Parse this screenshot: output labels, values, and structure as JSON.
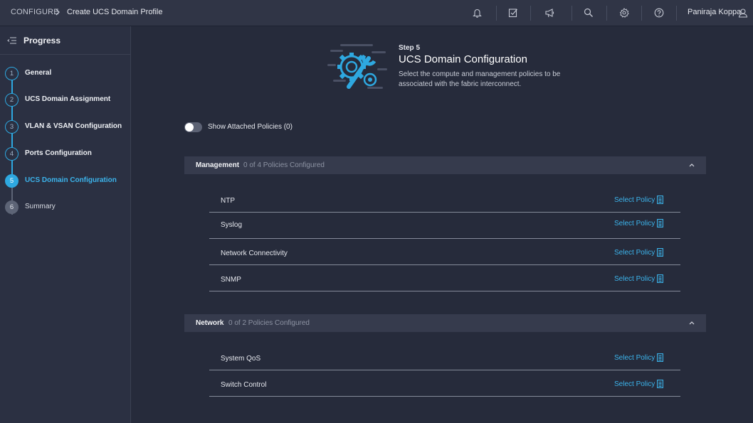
{
  "breadcrumb": {
    "root": "CONFIGURE",
    "page": "Create UCS Domain Profile"
  },
  "topbar": {
    "icons": [
      "bell-icon",
      "tasks-check-icon",
      "announcement-megaphone-icon",
      "search-icon",
      "gear-icon",
      "help-icon",
      "user-icon"
    ],
    "user_name": "Paniraja Koppa"
  },
  "sidebar": {
    "title": "Progress",
    "steps": [
      {
        "number": "1",
        "label": "General",
        "state": "done"
      },
      {
        "number": "2",
        "label": "UCS Domain Assignment",
        "state": "done"
      },
      {
        "number": "3",
        "label": "VLAN & VSAN Configuration",
        "state": "done"
      },
      {
        "number": "4",
        "label": "Ports Configuration",
        "state": "done"
      },
      {
        "number": "5",
        "label": "UCS Domain Configuration",
        "state": "active"
      },
      {
        "number": "6",
        "label": "Summary",
        "state": "todo"
      }
    ]
  },
  "main": {
    "step_number": "Step 5",
    "title": "UCS Domain Configuration",
    "description": "Select the compute and management policies to be associated with the fabric interconnect.",
    "toggle_label": "Show Attached Policies (0)",
    "toggle_on": false
  },
  "sections": [
    {
      "title": "Management",
      "count": "0 of 4 Policies Configured",
      "rows": [
        {
          "label": "NTP",
          "action": "Select Policy"
        },
        {
          "label": "Syslog",
          "action": "Select Policy"
        },
        {
          "label": "Network Connectivity",
          "action": "Select Policy"
        },
        {
          "label": "SNMP",
          "action": "Select Policy"
        }
      ]
    },
    {
      "title": "Network",
      "count": "0 of 2 Policies Configured",
      "rows": [
        {
          "label": "System QoS",
          "action": "Select Policy"
        },
        {
          "label": "Switch Control",
          "action": "Select Policy"
        }
      ]
    }
  ],
  "colors": {
    "accent": "#2ea8e0",
    "background": "#262b3b",
    "sidebar": "#2b3042",
    "topbar": "#303546"
  }
}
